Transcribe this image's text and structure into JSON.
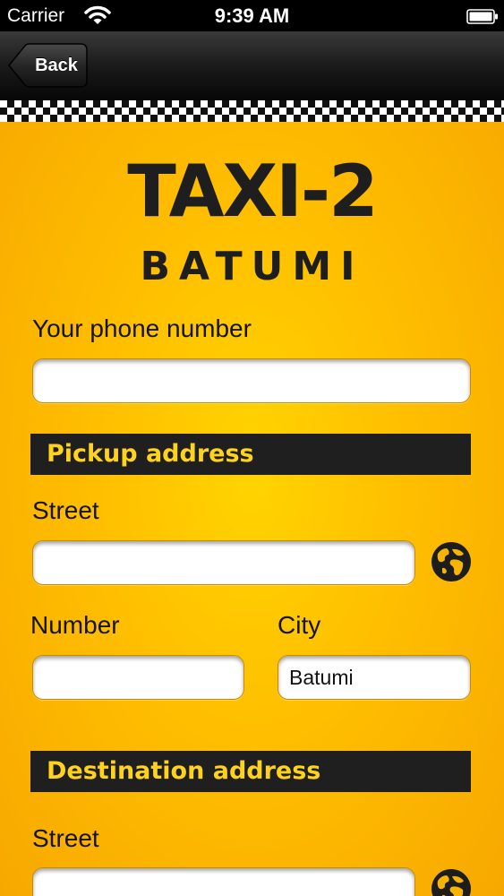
{
  "status_bar": {
    "carrier": "Carrier",
    "time": "9:39 AM",
    "wifi_icon": "wifi-icon",
    "battery_icon": "battery-icon"
  },
  "nav": {
    "back_label": "Back"
  },
  "logo": {
    "title": "TAXI-2",
    "subtitle": "BATUMI"
  },
  "phone": {
    "label": "Your phone number",
    "value": ""
  },
  "pickup": {
    "header": "Pickup address",
    "street_label": "Street",
    "street_value": "",
    "number_label": "Number",
    "number_value": "",
    "city_label": "City",
    "city_value": "Batumi",
    "locate_icon": "globe-icon"
  },
  "destination": {
    "header": "Destination address",
    "street_label": "Street",
    "street_value": "",
    "locate_icon": "globe-icon"
  },
  "colors": {
    "accent_yellow": "#ffc300",
    "header_text": "#ffd21c",
    "header_bg": "#1f1f1f"
  }
}
